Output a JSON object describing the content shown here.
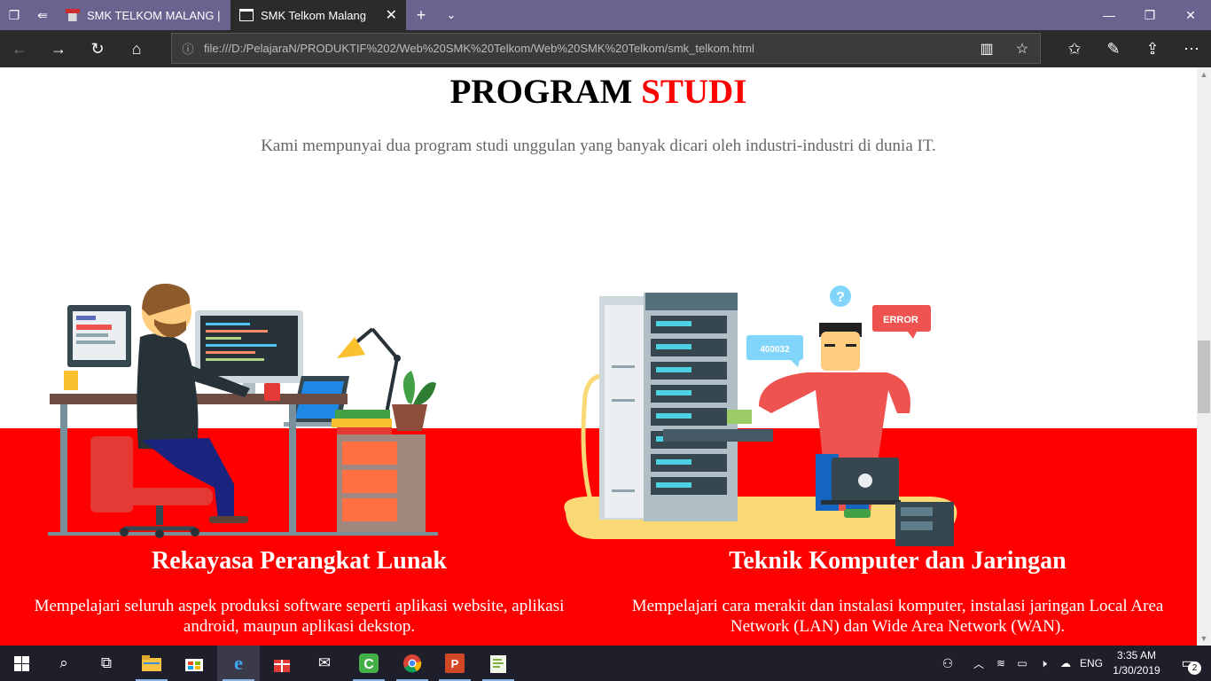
{
  "browser": {
    "tabs": [
      {
        "label": "SMK TELKOM MALANG | Th",
        "active": false
      },
      {
        "label": "SMK Telkom Malang",
        "active": true
      }
    ],
    "url": "file:///D:/PelajaraN/PRODUKTIF%202/Web%20SMK%20Telkom/Web%20SMK%20Telkom/smk_telkom.html"
  },
  "page": {
    "title_part1": "PROGRAM",
    "title_part2": "STUDI",
    "subtitle": "Kami mempunyai dua program studi unggulan yang banyak dicari oleh industri-industri di dunia IT.",
    "programs": [
      {
        "title": "Rekayasa Perangkat Lunak",
        "description": "Mempelajari seluruh aspek produksi software seperti aplikasi website, aplikasi android, maupun aplikasi dekstop."
      },
      {
        "title": "Teknik Komputer dan Jaringan",
        "description": "Mempelajari cara merakit dan instalasi komputer, instalasi jaringan Local Area Network (LAN) dan Wide Area Network (WAN)."
      }
    ],
    "illustration_tkj": {
      "badge_left": "400032",
      "badge_right": "ERROR",
      "question": "?"
    },
    "colors": {
      "accent": "#ff0000",
      "tabbar": "#6a6390",
      "toolbar": "#2b2b2b"
    }
  },
  "taskbar": {
    "language": "ENG",
    "time": "3:35 AM",
    "date": "1/30/2019",
    "notifications": "2"
  }
}
